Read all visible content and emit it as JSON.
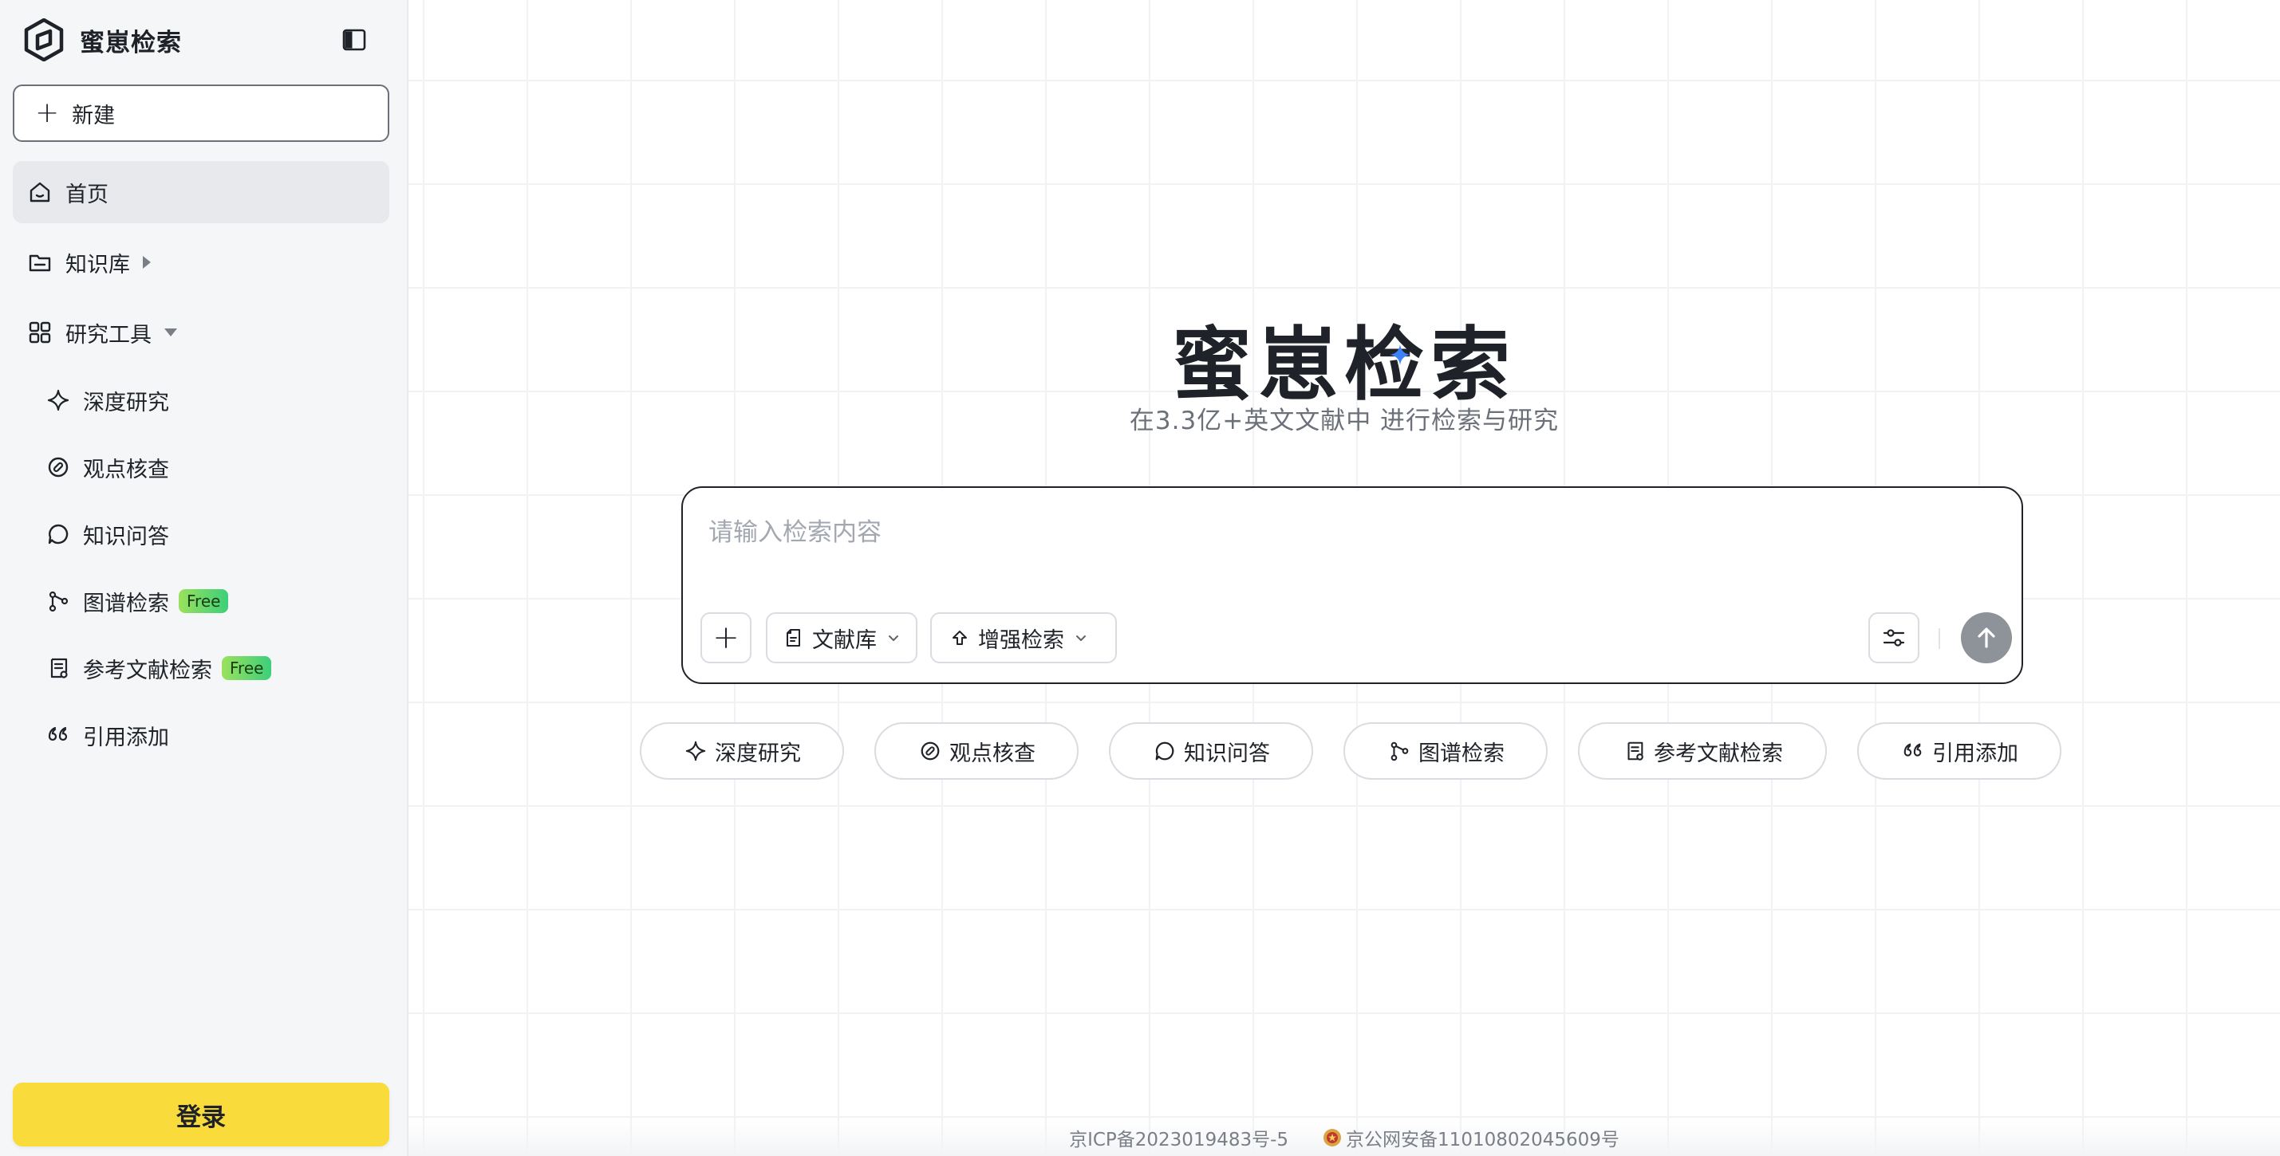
{
  "brand": {
    "name": "蜜崽检索"
  },
  "sidebar": {
    "new_label": "新建",
    "nav": {
      "home": "首页",
      "knowledge_base": "知识库",
      "research_tools": "研究工具"
    },
    "tools": [
      {
        "label": "深度研究",
        "badge": ""
      },
      {
        "label": "观点核查",
        "badge": ""
      },
      {
        "label": "知识问答",
        "badge": ""
      },
      {
        "label": "图谱检索",
        "badge": "Free"
      },
      {
        "label": "参考文献检索",
        "badge": "Free"
      },
      {
        "label": "引用添加",
        "badge": ""
      }
    ],
    "login_label": "登录"
  },
  "hero": {
    "title": "蜜崽检索",
    "subtitle": "在3.3亿+英文文献中 进行检索与研究"
  },
  "search": {
    "placeholder": "请输入检索内容",
    "value": "",
    "library_label": "文献库",
    "enhance_label": "增强检索"
  },
  "chips": [
    {
      "label": "深度研究"
    },
    {
      "label": "观点核查"
    },
    {
      "label": "知识问答"
    },
    {
      "label": "图谱检索"
    },
    {
      "label": "参考文献检索"
    },
    {
      "label": "引用添加"
    }
  ],
  "footer": {
    "icp": "京ICP备2023019483号-5",
    "police": "京公网安备11010802045609号"
  },
  "colors": {
    "accent_login": "#fadb3c",
    "free_badge": "#3ccf7a",
    "send_button": "#8e9299",
    "spark": "#3b82f6"
  }
}
